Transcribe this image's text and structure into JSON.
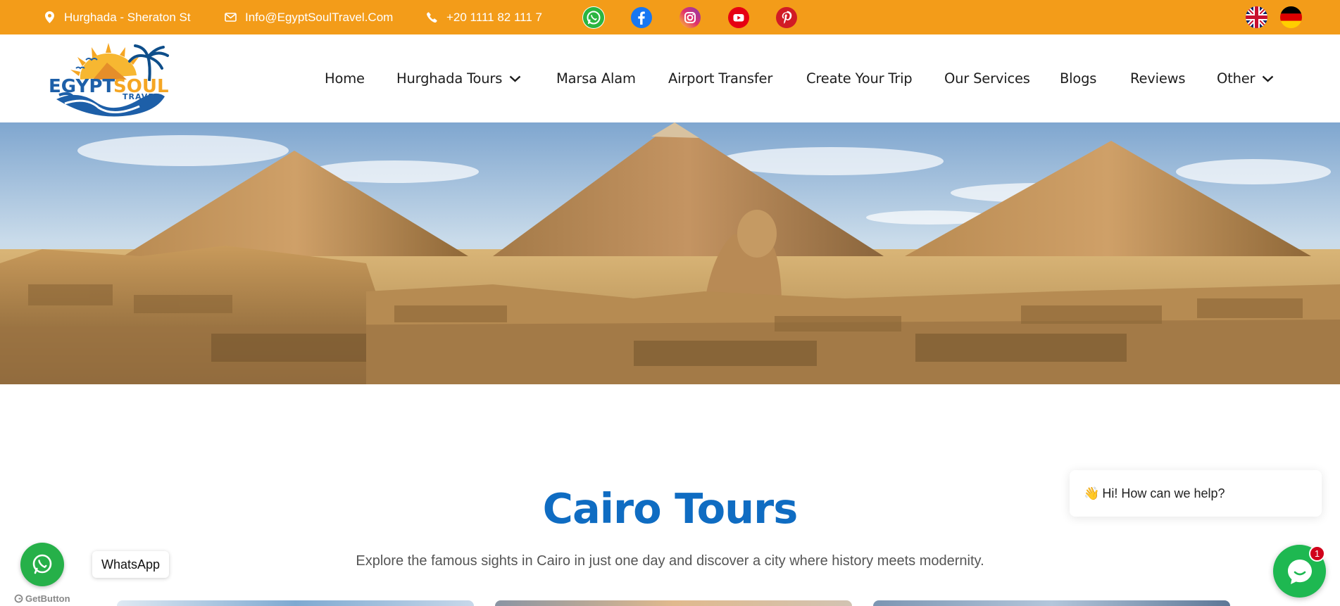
{
  "topbar": {
    "address": "Hurghada - Sheraton St",
    "email": "Info@EgyptSoulTravel.Com",
    "phone": "+20 1111 82 111 7",
    "background": "#F39C19",
    "social_icons": [
      "whatsapp-icon",
      "facebook-icon",
      "instagram-icon",
      "youtube-icon",
      "pinterest-icon"
    ],
    "languages": [
      "english-flag-icon",
      "german-flag-icon"
    ]
  },
  "logo": {
    "line1a": "EGYPT",
    "line1b": "SOUL",
    "line2": "TRAVEL"
  },
  "nav": {
    "items": [
      {
        "label": "Home"
      },
      {
        "label": "Hurghada Tours"
      },
      {
        "label": "Marsa Alam"
      },
      {
        "label": "Airport Transfer"
      },
      {
        "label": "Create Your Trip"
      },
      {
        "label": "Our Services"
      },
      {
        "label": "Blogs"
      },
      {
        "label": "Reviews"
      },
      {
        "label": "Other"
      }
    ]
  },
  "hero": {
    "image_icon": "pyramids-sphinx-photo"
  },
  "section": {
    "title": "Cairo Tours",
    "subtitle": "Explore the famous sights in Cairo in just one day and discover a city where history meets modernity.",
    "title_color": "#0F6CC2"
  },
  "floating": {
    "whatsapp_label": "WhatsApp",
    "getbutton_label": "GetButton",
    "chat_greeting": "Hi! How can we help?",
    "chat_emoji": "👋",
    "chat_badge_count": "1"
  }
}
